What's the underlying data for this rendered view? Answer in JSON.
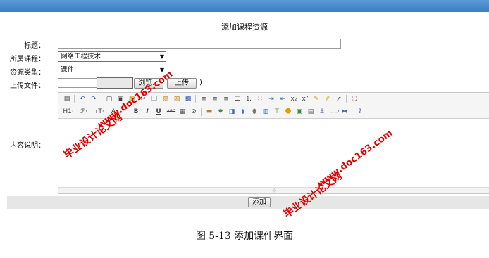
{
  "page": {
    "title": "添加课程资源"
  },
  "form": {
    "title_label": "标题：",
    "title_value": "",
    "course_label": "所属课程：",
    "course_value": "网络工程技术",
    "type_label": "资源类型：",
    "type_value": "课件",
    "upload_label": "上传文件：",
    "browse_label": "浏览...",
    "upload_button": "上传",
    "upload_suffix": ")",
    "content_label": "内容说明：",
    "submit_label": "添加"
  },
  "editor": {
    "toolbar_row1": [
      "source-icon",
      "undo-icon",
      "redo-icon",
      "new-page-icon",
      "preview-icon",
      "template-icon",
      "cut-icon",
      "copy-icon",
      "paste-icon",
      "paste-text-icon",
      "paste-word-icon",
      "align-left-icon",
      "align-center-icon",
      "align-right-icon",
      "justify-icon",
      "ordered-list-icon",
      "bullet-list-icon",
      "indent-icon",
      "outdent-icon",
      "subscript-icon",
      "superscript-icon",
      "clear-format-icon",
      "select-all-icon",
      "cursor-icon",
      "fullscreen-icon"
    ],
    "toolbar_row2": [
      "heading-icon",
      "font-family-icon",
      "font-size-icon",
      "font-color-icon",
      "bold-icon",
      "italic-icon",
      "underline-icon",
      "strikethrough-icon",
      "hr-icon",
      "remove-format-icon",
      "image-icon",
      "flash-icon",
      "media-icon",
      "insert-file-icon",
      "table-icon",
      "code-icon",
      "emoticon-icon",
      "map-icon",
      "pagebreak-icon",
      "anchor-icon",
      "link-icon",
      "unlink-icon",
      "help-icon"
    ],
    "heading_glyph": "H1·",
    "font_glyph": "ℱ·",
    "size_glyph": "тT·",
    "bold_glyph": "B",
    "italic_glyph": "I",
    "underline_glyph": "U",
    "strike_glyph": "ABC",
    "resize_glyph": "⊹"
  },
  "watermarks": {
    "text_cn": "毕业设计论文网",
    "text_url": "www.doc163.com"
  },
  "caption": "图 5-13 添加课件界面"
}
